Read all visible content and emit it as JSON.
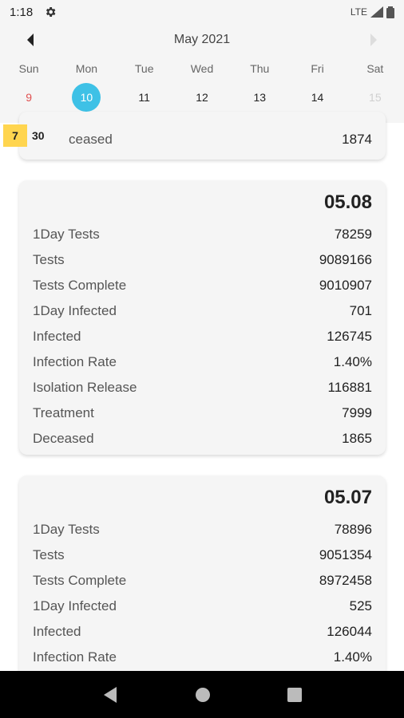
{
  "status": {
    "time": "1:18",
    "network": "LTE"
  },
  "calendar": {
    "month": "May 2021",
    "weekdays": [
      "Sun",
      "Mon",
      "Tue",
      "Wed",
      "Thu",
      "Fri",
      "Sat"
    ],
    "days": [
      "9",
      "10",
      "11",
      "12",
      "13",
      "14",
      "15"
    ],
    "selected_day": "10"
  },
  "overlay": {
    "badge": "7",
    "count": "30"
  },
  "partial_card": {
    "label": "ceased",
    "value": "1874"
  },
  "cards": [
    {
      "date": "05.08",
      "rows": [
        {
          "label": "1Day Tests",
          "value": "78259"
        },
        {
          "label": "Tests",
          "value": "9089166"
        },
        {
          "label": "Tests Complete",
          "value": "9010907"
        },
        {
          "label": "1Day Infected",
          "value": "701"
        },
        {
          "label": "Infected",
          "value": "126745"
        },
        {
          "label": "Infection Rate",
          "value": "1.40%"
        },
        {
          "label": "Isolation Release",
          "value": "116881"
        },
        {
          "label": "Treatment",
          "value": "7999"
        },
        {
          "label": "Deceased",
          "value": "1865"
        }
      ]
    },
    {
      "date": "05.07",
      "rows": [
        {
          "label": "1Day Tests",
          "value": "78896"
        },
        {
          "label": "Tests",
          "value": "9051354"
        },
        {
          "label": "Tests Complete",
          "value": "8972458"
        },
        {
          "label": "1Day Infected",
          "value": "525"
        },
        {
          "label": "Infected",
          "value": "126044"
        },
        {
          "label": "Infection Rate",
          "value": "1.40%"
        }
      ]
    }
  ],
  "colors": {
    "accent": "#3ec1e6",
    "sunday": "#e05050",
    "badge": "#ffd54f"
  }
}
